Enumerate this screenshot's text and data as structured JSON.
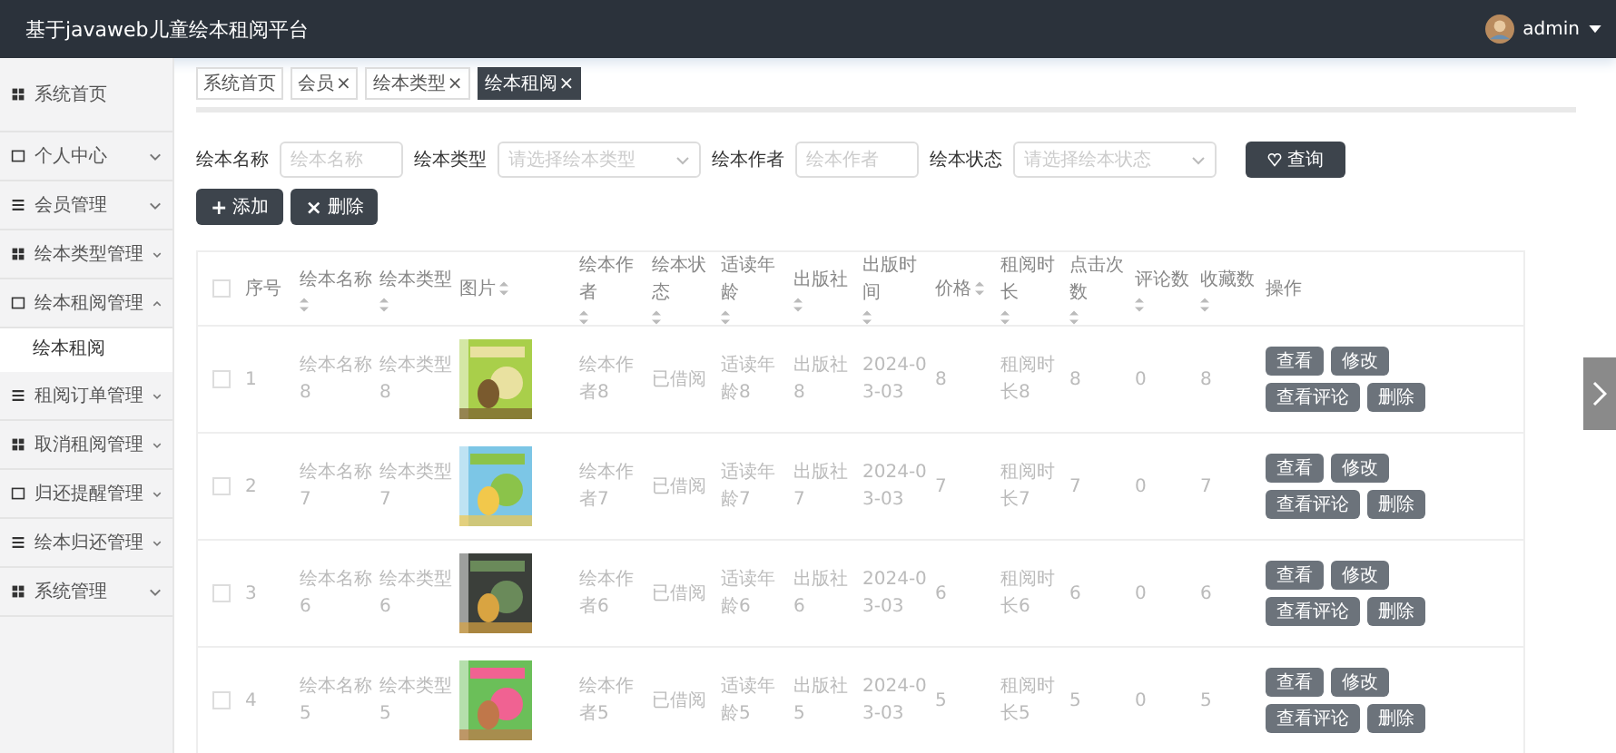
{
  "header": {
    "title": "基于javaweb儿童绘本租阅平台",
    "user": "admin"
  },
  "sidebar": {
    "items": [
      {
        "label": "系统首页"
      },
      {
        "label": "个人中心",
        "expanded": false
      },
      {
        "label": "会员管理",
        "expanded": false
      },
      {
        "label": "绘本类型管理",
        "expanded": false
      },
      {
        "label": "绘本租阅管理",
        "expanded": true,
        "children": [
          {
            "label": "绘本租阅",
            "selected": true
          }
        ]
      },
      {
        "label": "租阅订单管理",
        "expanded": false
      },
      {
        "label": "取消租阅管理",
        "expanded": false
      },
      {
        "label": "归还提醒管理",
        "expanded": false
      },
      {
        "label": "绘本归还管理",
        "expanded": false
      },
      {
        "label": "系统管理",
        "expanded": false
      }
    ]
  },
  "tabs": [
    {
      "label": "系统首页",
      "closable": false,
      "selected": false
    },
    {
      "label": "会员",
      "closable": true,
      "selected": false
    },
    {
      "label": "绘本类型",
      "closable": true,
      "selected": false
    },
    {
      "label": "绘本租阅",
      "closable": true,
      "selected": true
    }
  ],
  "search": {
    "fields": [
      {
        "label": "绘本名称",
        "kind": "input",
        "placeholder": "绘本名称"
      },
      {
        "label": "绘本类型",
        "kind": "select",
        "placeholder": "请选择绘本类型"
      },
      {
        "label": "绘本作者",
        "kind": "input",
        "placeholder": "绘本作者"
      },
      {
        "label": "绘本状态",
        "kind": "select",
        "placeholder": "请选择绘本状态"
      }
    ],
    "button": "查询"
  },
  "actions": [
    {
      "label": "添加",
      "icon": "+"
    },
    {
      "label": "删除",
      "icon": "×"
    }
  ],
  "table": {
    "select_all_checked": false,
    "columns": [
      {
        "label": "序号",
        "sortable": false
      },
      {
        "label": "绘本名称",
        "sortable": true
      },
      {
        "label": "绘本类型",
        "sortable": true
      },
      {
        "label": "图片",
        "sortable": true
      },
      {
        "label": "绘本作者",
        "sortable": true
      },
      {
        "label": "绘本状态",
        "sortable": true
      },
      {
        "label": "适读年龄",
        "sortable": true
      },
      {
        "label": "出版社",
        "sortable": true
      },
      {
        "label": "出版时间",
        "sortable": true
      },
      {
        "label": "价格",
        "sortable": true
      },
      {
        "label": "租阅时长",
        "sortable": true
      },
      {
        "label": "点击次数",
        "sortable": true
      },
      {
        "label": "评论数",
        "sortable": true
      },
      {
        "label": "收藏数",
        "sortable": true
      },
      {
        "label": "操作",
        "sortable": false
      }
    ],
    "rows": [
      {
        "checked": false,
        "cells": [
          "1",
          "绘本名称8",
          "绘本类型8",
          {
            "kind": "picture"
          },
          "绘本作者8",
          "已借阅",
          "适读年龄8",
          "出版社8",
          "2024-03-03",
          "8",
          "租阅时长8",
          "8",
          "0",
          "8"
        ],
        "buttons": [
          "查看",
          "修改",
          "查看评论",
          "删除"
        ]
      },
      {
        "checked": false,
        "cells": [
          "2",
          "绘本名称7",
          "绘本类型7",
          {
            "kind": "picture"
          },
          "绘本作者7",
          "已借阅",
          "适读年龄7",
          "出版社7",
          "2024-03-03",
          "7",
          "租阅时长7",
          "7",
          "0",
          "7"
        ],
        "buttons": [
          "查看",
          "修改",
          "查看评论",
          "删除"
        ]
      },
      {
        "checked": false,
        "cells": [
          "3",
          "绘本名称6",
          "绘本类型6",
          {
            "kind": "picture"
          },
          "绘本作者6",
          "已借阅",
          "适读年龄6",
          "出版社6",
          "2024-03-03",
          "6",
          "租阅时长6",
          "6",
          "0",
          "6"
        ],
        "buttons": [
          "查看",
          "修改",
          "查看评论",
          "删除"
        ]
      },
      {
        "checked": false,
        "cells": [
          "4",
          "绘本名称5",
          "绘本类型5",
          {
            "kind": "picture"
          },
          "绘本作者5",
          "已借阅",
          "适读年龄5",
          "出版社5",
          "2024-03-03",
          "5",
          "租阅时长5",
          "5",
          "0",
          "5"
        ],
        "buttons": [
          "查看",
          "修改",
          "查看评论",
          "删除"
        ]
      }
    ]
  }
}
